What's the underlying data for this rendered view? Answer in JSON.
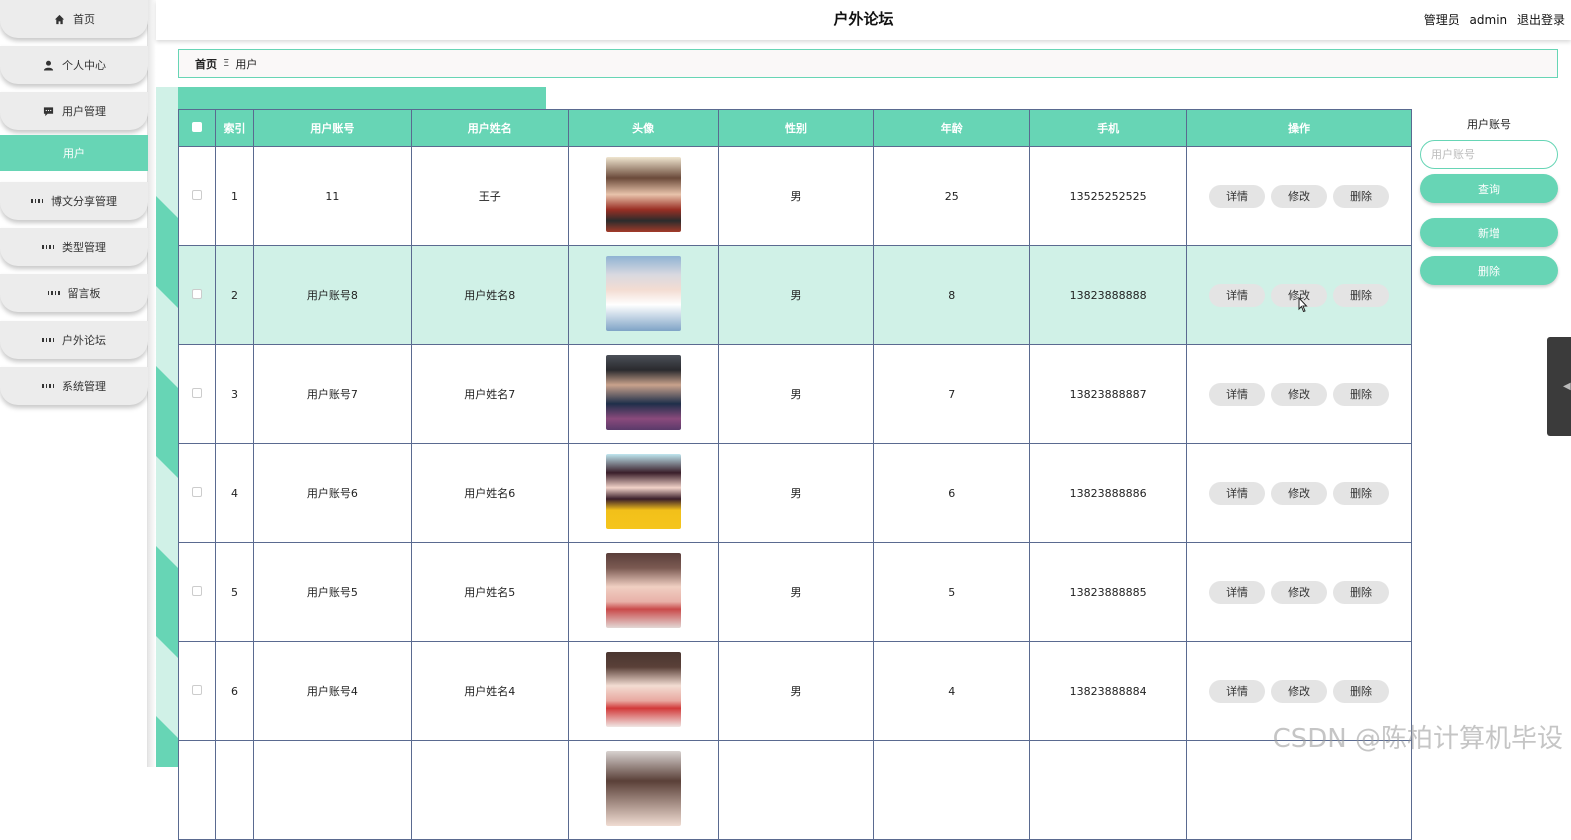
{
  "sidebar": {
    "items": [
      {
        "label": "首页",
        "icon": "home-icon"
      },
      {
        "label": "个人中心",
        "icon": "person-icon"
      },
      {
        "label": "用户管理",
        "icon": "chat-icon"
      },
      {
        "label": "用户",
        "icon": "",
        "active": true
      },
      {
        "label": "博文分享管理",
        "icon": "grid-icon"
      },
      {
        "label": "类型管理",
        "icon": "grid-icon"
      },
      {
        "label": "留言板",
        "icon": "grid-icon"
      },
      {
        "label": "户外论坛",
        "icon": "grid-icon"
      },
      {
        "label": "系统管理",
        "icon": "grid-icon"
      }
    ]
  },
  "header": {
    "title": "户外论坛",
    "role": "管理员",
    "username": "admin",
    "logout": "退出登录"
  },
  "breadcrumb": {
    "home": "首页",
    "separator": "Ξ",
    "current": "用户"
  },
  "table": {
    "columns": [
      "索引",
      "用户账号",
      "用户姓名",
      "头像",
      "性别",
      "年龄",
      "手机",
      "操作"
    ],
    "rows": [
      {
        "index": "1",
        "account": "11",
        "name": "王子",
        "gender": "男",
        "age": "25",
        "phone": "13525252525"
      },
      {
        "index": "2",
        "account": "用户账号8",
        "name": "用户姓名8",
        "gender": "男",
        "age": "8",
        "phone": "13823888888"
      },
      {
        "index": "3",
        "account": "用户账号7",
        "name": "用户姓名7",
        "gender": "男",
        "age": "7",
        "phone": "13823888887"
      },
      {
        "index": "4",
        "account": "用户账号6",
        "name": "用户姓名6",
        "gender": "男",
        "age": "6",
        "phone": "13823888886"
      },
      {
        "index": "5",
        "account": "用户账号5",
        "name": "用户姓名5",
        "gender": "男",
        "age": "5",
        "phone": "13823888885"
      },
      {
        "index": "6",
        "account": "用户账号4",
        "name": "用户姓名4",
        "gender": "男",
        "age": "4",
        "phone": "13823888884"
      }
    ],
    "actions": {
      "detail": "详情",
      "edit": "修改",
      "delete": "删除"
    }
  },
  "search": {
    "label": "用户账号",
    "placeholder": "用户账号",
    "query_button": "查询",
    "add_button": "新增",
    "delete_button": "删除"
  },
  "watermark": "CSDN @陈柏计算机毕设",
  "colors": {
    "accent": "#67d5b5",
    "highlight_row": "#d0f1e7",
    "border": "#5a6a90"
  }
}
